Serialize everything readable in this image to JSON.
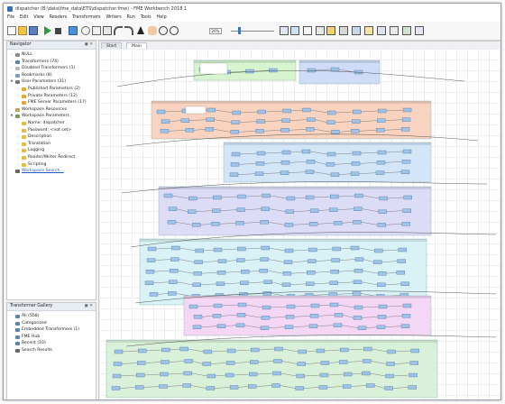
{
  "window": {
    "title": "dispatcher (B:\\data\\fme_data\\ETS\\dispatcher.fmw) - FME Workbench 2018.1"
  },
  "menu": [
    "File",
    "Edit",
    "View",
    "Readers",
    "Transformers",
    "Writers",
    "Run",
    "Tools",
    "Help"
  ],
  "toolbar": {
    "zoom_value": "26%",
    "icons": [
      "new-icon",
      "open-icon",
      "save-icon",
      "run-icon",
      "stop-icon",
      "feature-caching-icon",
      "cut-icon",
      "copy-icon",
      "paste-icon",
      "undo-icon",
      "redo-icon",
      "select-icon",
      "pan-icon",
      "zoom-in-icon",
      "zoom-out-icon",
      "zoom-extents-icon",
      "overview-icon",
      "bookmark-icon",
      "annotation-icon",
      "properties-icon",
      "print-icon",
      "layout-icon"
    ]
  },
  "navigator": {
    "title": "Navigator",
    "items": [
      {
        "label": "NULL",
        "indent": 0,
        "expand": "collapsed",
        "icon": "writer-icon"
      },
      {
        "label": "Transformers (74)",
        "indent": 0,
        "expand": "collapsed",
        "icon": "transformer-icon"
      },
      {
        "label": "Disabled Transformers (1)",
        "indent": 0,
        "expand": "collapsed",
        "icon": "disabled-transformer-icon"
      },
      {
        "label": "Bookmarks (8)",
        "indent": 0,
        "expand": "collapsed",
        "icon": "bookmark-icon"
      },
      {
        "label": "User Parameters (31)",
        "indent": 0,
        "expand": "expanded",
        "icon": "user-parameters-icon"
      },
      {
        "label": "Published Parameters (2)",
        "indent": 1,
        "expand": "collapsed",
        "icon": "published-parameters-icon"
      },
      {
        "label": "Private Parameters (12)",
        "indent": 1,
        "expand": "collapsed",
        "icon": "private-parameters-icon"
      },
      {
        "label": "FME Server Parameters (17)",
        "indent": 1,
        "expand": "collapsed",
        "icon": "server-parameters-icon"
      },
      {
        "label": "Workspace Resources",
        "indent": 0,
        "expand": "none",
        "icon": "resources-icon"
      },
      {
        "label": "Workspace Parameters",
        "indent": 0,
        "expand": "expanded",
        "icon": "workspace-parameters-icon"
      },
      {
        "label": "Name: dispatcher",
        "indent": 1,
        "expand": "none",
        "icon": "parameter-icon"
      },
      {
        "label": "Password: <not set>",
        "indent": 1,
        "expand": "none",
        "icon": "parameter-icon"
      },
      {
        "label": "Description",
        "indent": 1,
        "expand": "collapsed",
        "icon": "parameter-icon"
      },
      {
        "label": "Translation",
        "indent": 1,
        "expand": "collapsed",
        "icon": "parameter-icon"
      },
      {
        "label": "Logging",
        "indent": 1,
        "expand": "collapsed",
        "icon": "parameter-icon"
      },
      {
        "label": "Reader/Writer Redirect",
        "indent": 1,
        "expand": "collapsed",
        "icon": "parameter-icon"
      },
      {
        "label": "Scripting",
        "indent": 1,
        "expand": "collapsed",
        "icon": "parameter-icon"
      },
      {
        "label": "Workspace Search...",
        "indent": 0,
        "expand": "none",
        "icon": "search-icon",
        "link": true
      }
    ]
  },
  "gallery": {
    "title": "Transformer Gallery",
    "items": [
      {
        "label": "All (558)",
        "icon": "transformer-icon"
      },
      {
        "label": "Categorized",
        "icon": "category-icon"
      },
      {
        "label": "Embedded Transformers (1)",
        "icon": "embedded-icon"
      },
      {
        "label": "FME Hub",
        "icon": "hub-icon"
      },
      {
        "label": "Recent (10)",
        "icon": "recent-icon"
      },
      {
        "label": "Search Results",
        "icon": "search-icon"
      }
    ]
  },
  "tabs": [
    "Start",
    "Main"
  ],
  "active_tab": "Main",
  "colors": {
    "bookmark_green": "#d6f5cf",
    "bookmark_blue": "#cfdcf7",
    "bookmark_orange": "#f8d3c0",
    "bookmark_lightblue": "#d2e6f7",
    "bookmark_lavender": "#dcdcf6",
    "bookmark_cyan": "#d9f2f5",
    "bookmark_pink": "#f4d7f4",
    "bookmark_green2": "#d9f1d9",
    "transformer_fill": "#9fc2e6",
    "link_color": "#1f5bc1"
  }
}
